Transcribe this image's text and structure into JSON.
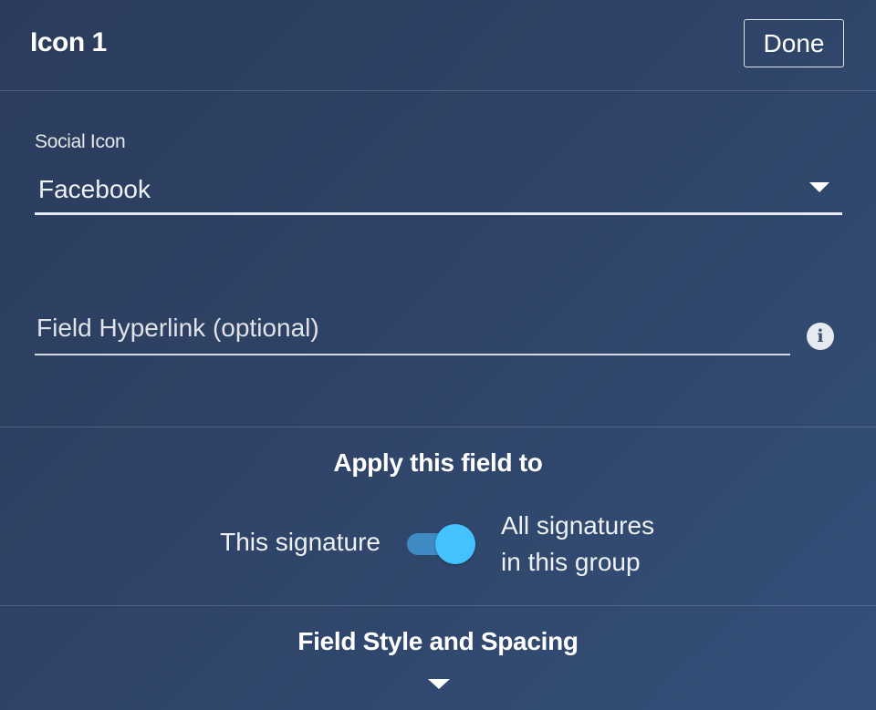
{
  "header": {
    "title": "Icon 1",
    "done_label": "Done"
  },
  "social_icon": {
    "label": "Social Icon",
    "selected": "Facebook"
  },
  "hyperlink": {
    "placeholder": "Field Hyperlink (optional)",
    "value": ""
  },
  "apply": {
    "title": "Apply this field to",
    "left_label": "This signature",
    "right_label_line1": "All signatures",
    "right_label_line2": "in this group",
    "toggle_on": true
  },
  "style_section": {
    "title": "Field Style and Spacing"
  },
  "icons": {
    "info": "info-icon",
    "select_arrow": "chevron-down-icon",
    "expand": "chevron-down-icon"
  },
  "colors": {
    "background": "#2f4468",
    "toggle_knob": "#44c1ff",
    "toggle_track": "#3f8bc4"
  }
}
